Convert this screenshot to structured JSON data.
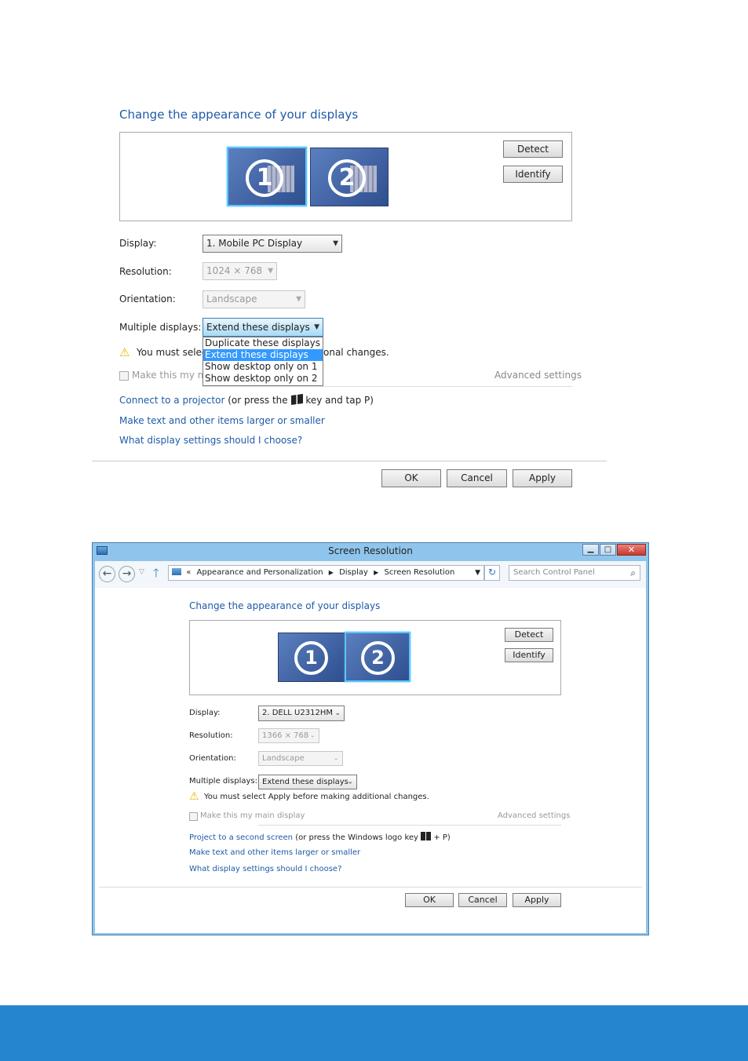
{
  "top": {
    "title": "Change the appearance of your displays",
    "monitors": [
      "1",
      "2"
    ],
    "selected_monitor": "1",
    "detect": "Detect",
    "identify": "Identify",
    "rows": [
      {
        "label": "Display:",
        "value": "1. Mobile PC Display",
        "disabled": false
      },
      {
        "label": "Resolution:",
        "value": "1024 × 768",
        "disabled": true
      },
      {
        "label": "Orientation:",
        "value": "Landscape",
        "disabled": true
      },
      {
        "label": "Multiple displays:",
        "value": "Extend these displays",
        "disabled": false
      }
    ],
    "dropdown_options": [
      "Duplicate these displays",
      "Extend these displays",
      "Show desktop only on 1",
      "Show desktop only on 2"
    ],
    "dropdown_selected": 1,
    "warning_left": "You must selec",
    "warning_right": "onal changes.",
    "checkbox_label": "Make this my ma",
    "advanced": "Advanced settings",
    "link_projector": "Connect to a projector",
    "projector_rest_a": "(or press the",
    "projector_rest_b": "key and tap P)",
    "link_text": "Make text and other items larger or smaller",
    "link_what": "What display settings should I choose?",
    "ok": "OK",
    "cancel": "Cancel",
    "apply": "Apply"
  },
  "bottom": {
    "window_title": "Screen Resolution",
    "breadcrumb": [
      "Appearance and Personalization",
      "Display",
      "Screen Resolution"
    ],
    "breadcrumb_prefix": "«",
    "search_placeholder": "Search Control Panel",
    "title": "Change the appearance of your displays",
    "monitors": [
      "1",
      "2"
    ],
    "selected_monitor": "2",
    "detect": "Detect",
    "identify": "Identify",
    "rows": [
      {
        "label": "Display:",
        "value": "2. DELL U2312HM",
        "disabled": false
      },
      {
        "label": "Resolution:",
        "value": "1366 × 768",
        "disabled": true
      },
      {
        "label": "Orientation:",
        "value": "Landscape",
        "disabled": true
      },
      {
        "label": "Multiple displays:",
        "value": "Extend these displays",
        "disabled": false
      }
    ],
    "warning": "You must select Apply before making additional changes.",
    "checkbox_label": "Make this my main display",
    "advanced": "Advanced settings",
    "link_project": "Project to a second screen",
    "project_rest_a": "(or press the Windows logo key",
    "project_rest_b": "+ P)",
    "link_text": "Make text and other items larger or smaller",
    "link_what": "What display settings should I choose?",
    "ok": "OK",
    "cancel": "Cancel",
    "apply": "Apply"
  },
  "colors": {
    "link": "#1e5aa8",
    "footer_band": "#2586cf",
    "window_frame": "#8fc5ec",
    "highlight": "#3399ff"
  }
}
